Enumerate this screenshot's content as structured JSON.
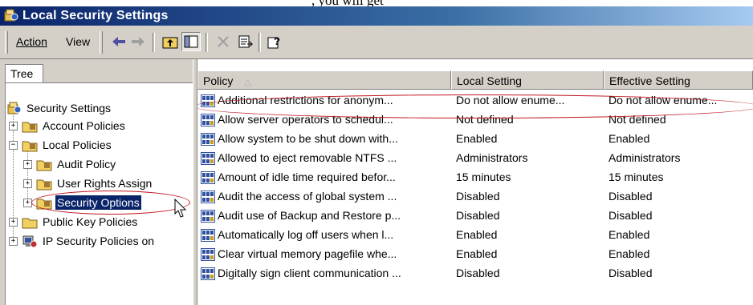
{
  "window": {
    "title": "Local Security Settings",
    "caption_fragment": ", you will get"
  },
  "toolbar": {
    "menu_action": "Action",
    "menu_view": "View"
  },
  "tree": {
    "tab_label": "Tree",
    "nodes": [
      {
        "label": "Security Settings"
      },
      {
        "label": "Account Policies"
      },
      {
        "label": "Local Policies"
      },
      {
        "label": "Audit Policy"
      },
      {
        "label": "User Rights Assign"
      },
      {
        "label": "Security Options"
      },
      {
        "label": "Public Key Policies"
      },
      {
        "label": "IP Security Policies on"
      }
    ]
  },
  "list": {
    "columns": [
      "Policy",
      "Local Setting",
      "Effective Setting"
    ],
    "rows": [
      {
        "policy": "Additional restrictions for anonym...",
        "local": "Do not allow enume...",
        "effective": "Do not allow enume..."
      },
      {
        "policy": "Allow server operators to schedul...",
        "local": "Not defined",
        "effective": "Not defined"
      },
      {
        "policy": "Allow system to be shut down with...",
        "local": "Enabled",
        "effective": "Enabled"
      },
      {
        "policy": "Allowed to eject removable NTFS ...",
        "local": "Administrators",
        "effective": "Administrators"
      },
      {
        "policy": "Amount of idle time required befor...",
        "local": "15 minutes",
        "effective": "15 minutes"
      },
      {
        "policy": "Audit the access of global system ...",
        "local": "Disabled",
        "effective": "Disabled"
      },
      {
        "policy": "Audit use of Backup and Restore p...",
        "local": "Disabled",
        "effective": "Disabled"
      },
      {
        "policy": "Automatically log off users when l...",
        "local": "Enabled",
        "effective": "Enabled"
      },
      {
        "policy": "Clear virtual memory pagefile whe...",
        "local": "Enabled",
        "effective": "Enabled"
      },
      {
        "policy": "Digitally sign client communication ...",
        "local": "Disabled",
        "effective": "Disabled"
      }
    ]
  },
  "colors": {
    "title_bar": "#0a246a",
    "selection": "#0a246a",
    "annotation": "#c0141e",
    "chrome": "#d4d0c8"
  }
}
